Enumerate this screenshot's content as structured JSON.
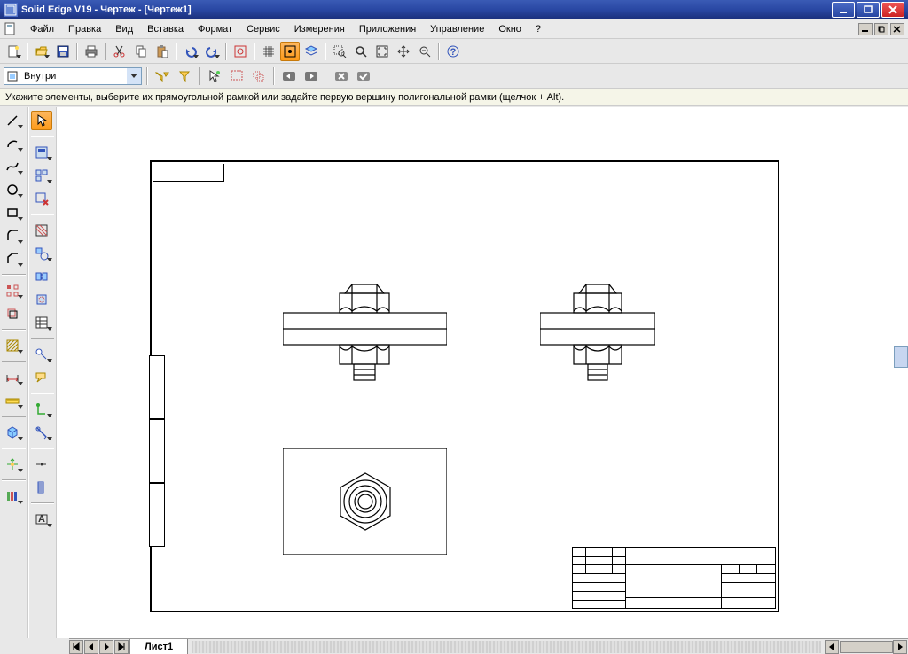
{
  "title": "Solid Edge V19 - Чертеж - [Чертеж1]",
  "menu": {
    "file": "Файл",
    "edit": "Правка",
    "view": "Вид",
    "insert": "Вставка",
    "format": "Формат",
    "service": "Сервис",
    "measure": "Измерения",
    "apps": "Приложения",
    "manage": "Управление",
    "window": "Окно",
    "help": "?"
  },
  "combo": {
    "value": "Внутри"
  },
  "hint": "Укажите элементы, выберите их прямоугольной рамкой или задайте первую вершину полигональной рамки (щелчок + Alt).",
  "sheet_tab": "Лист1"
}
